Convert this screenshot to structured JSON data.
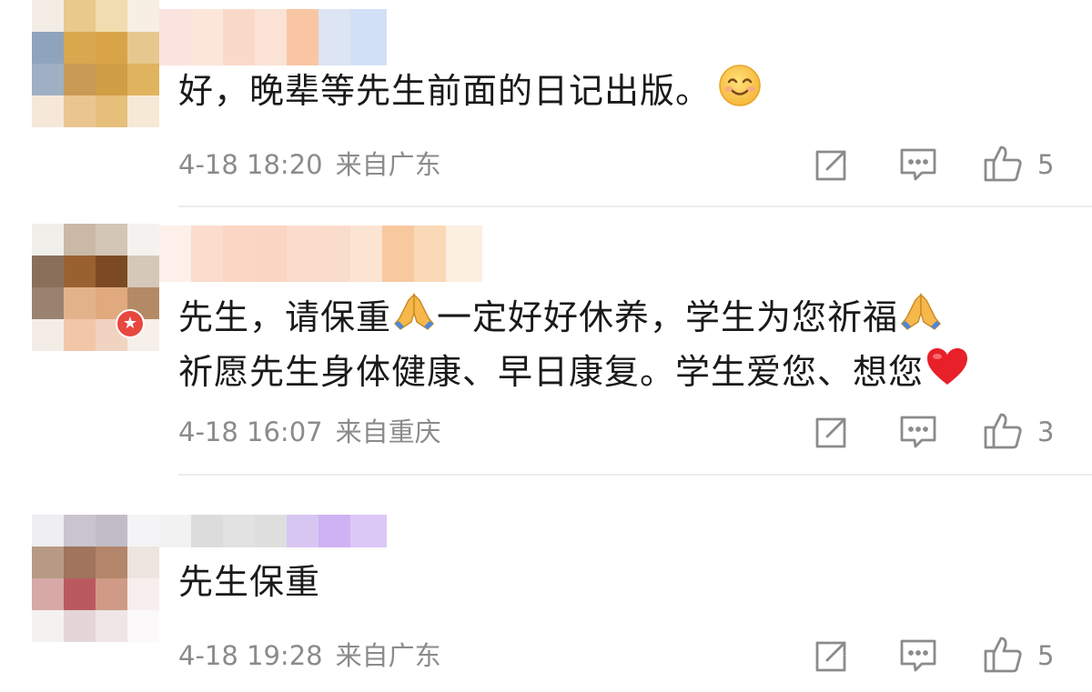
{
  "comments": [
    {
      "text_lines": [
        "好，晚辈等先生前面的日记出版。"
      ],
      "emojis": [
        "smiling-face-icon"
      ],
      "time": "4-18 18:20",
      "location": "来自广东",
      "likes": "5"
    },
    {
      "text_lines": [
        "先生，请保重",
        "一定好好休养，学生为您祈福",
        "祈愿先生身体健康、早日康复。学生爱您、想您"
      ],
      "emojis": [
        "praying-hands-icon",
        "praying-hands-icon",
        "red-heart-icon"
      ],
      "time": "4-18 16:07",
      "location": "来自重庆",
      "likes": "3"
    },
    {
      "text_lines": [
        "先生保重"
      ],
      "emojis": [],
      "time": "4-18 19:28",
      "location": "来自广东",
      "likes": "5"
    }
  ],
  "icons": {
    "share": "share-icon",
    "reply": "comment-icon",
    "like": "thumbs-up-icon"
  },
  "colors": {
    "text": "#1a1a1a",
    "meta": "#8b8b8b",
    "divider": "#ececec",
    "badge": "#e8473f"
  }
}
